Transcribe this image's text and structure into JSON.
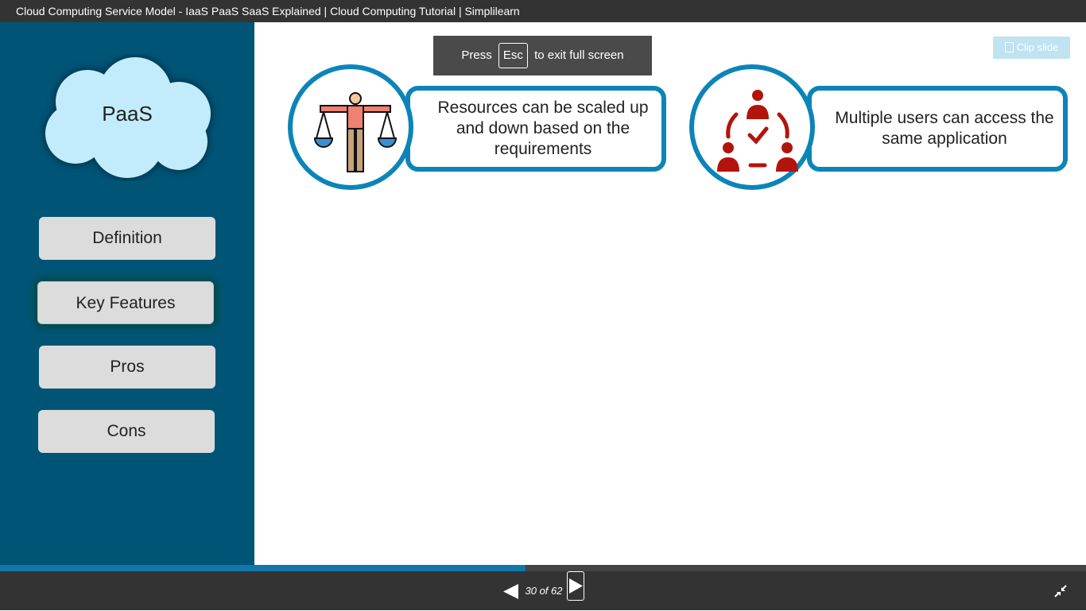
{
  "window": {
    "title": "Cloud Computing Service Model - IaaS PaaS SaaS Explained | Cloud Computing Tutorial | Simplilearn"
  },
  "sidebar": {
    "heading": "PaaS",
    "items": [
      {
        "label": "Definition"
      },
      {
        "label": "Key Features",
        "active": true
      },
      {
        "label": "Pros"
      },
      {
        "label": "Cons"
      }
    ]
  },
  "fullscreen_notice": {
    "before": "Press",
    "key": "Esc",
    "after": "to exit full screen"
  },
  "clip_button": {
    "label": "Clip slide",
    "icon": "clip-icon"
  },
  "features": [
    {
      "text": "Resources can be scaled up and down based on the requirements",
      "icon": "scale-balance-icon"
    },
    {
      "text": "Multiple users can access the same application",
      "icon": "multi-user-icon"
    }
  ],
  "player": {
    "progress_fraction": 0.484,
    "page_counter": "30 of 62"
  },
  "colors": {
    "sidebar_bg": "#005577",
    "accent_blue": "#0b85b8",
    "icon_red": "#b2140c",
    "button_bg": "#dcdcdc"
  }
}
